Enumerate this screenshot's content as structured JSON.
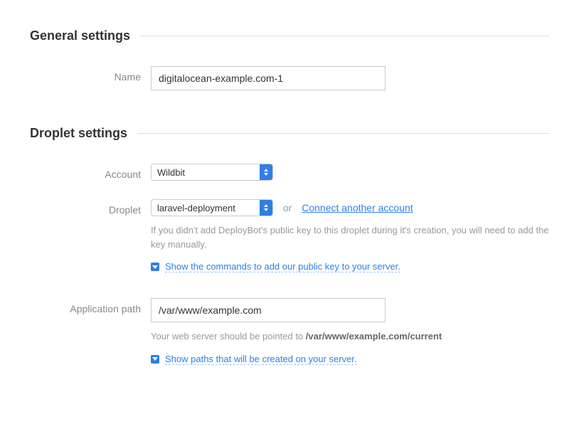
{
  "general": {
    "title": "General settings",
    "name_label": "Name",
    "name_value": "digitalocean-example.com-1"
  },
  "droplet": {
    "title": "Droplet settings",
    "account_label": "Account",
    "account_value": "Wildbit",
    "droplet_label": "Droplet",
    "droplet_value": "laravel-deployment",
    "or_text": "or",
    "connect_link": "Connect another account",
    "key_help": "If you didn't add DeployBot's public key to this droplet during it's creation, you will need to add the key manually.",
    "show_commands_link": "Show the commands to add our public key to your server",
    "app_path_label": "Application path",
    "app_path_value": "/var/www/example.com",
    "path_help_prefix": "Your web server should be pointed to ",
    "path_help_value": "/var/www/example.com/current",
    "show_paths_link": "Show paths that will be created on your server"
  }
}
